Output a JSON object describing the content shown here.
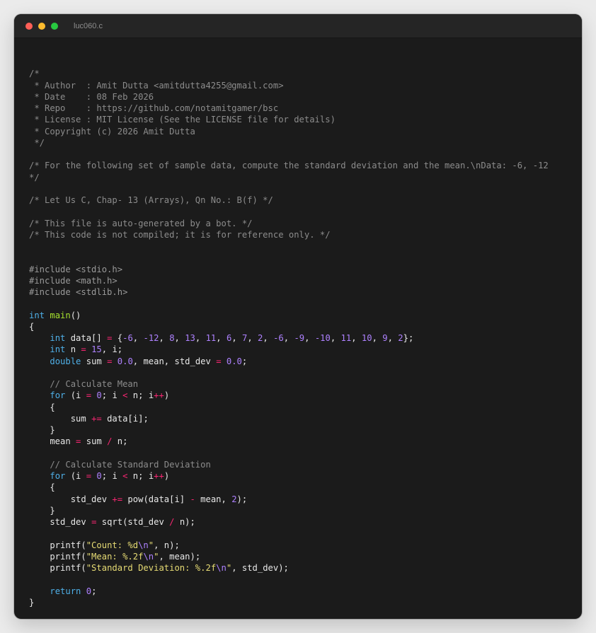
{
  "window": {
    "title": "luc060.c"
  },
  "colors": {
    "background": "#1b1b1b",
    "titlebar": "#252525",
    "close": "#ff5f57",
    "minimize": "#febc2e",
    "maximize": "#28c840",
    "comment": "#8c8c8c",
    "keyword": "#4fb0e8",
    "function": "#a6e22e",
    "number": "#ae81ff",
    "operator": "#f92672",
    "string": "#e6db74"
  },
  "code": {
    "lines": [
      [],
      [
        {
          "t": "/*",
          "c": "comment"
        }
      ],
      [
        {
          "t": " * Author  : Amit Dutta <amitdutta4255@gmail.com>",
          "c": "comment"
        }
      ],
      [
        {
          "t": " * Date    : 08 Feb 2026",
          "c": "comment"
        }
      ],
      [
        {
          "t": " * Repo    : https://github.com/notamitgamer/bsc",
          "c": "comment"
        }
      ],
      [
        {
          "t": " * License : MIT License (See the LICENSE file for details)",
          "c": "comment"
        }
      ],
      [
        {
          "t": " * Copyright (c) 2026 Amit Dutta",
          "c": "comment"
        }
      ],
      [
        {
          "t": " */",
          "c": "comment"
        }
      ],
      [],
      [
        {
          "t": "/* For the following set of sample data, compute the standard deviation and the mean.\\nData: -6, -12",
          "c": "comment"
        }
      ],
      [
        {
          "t": "*/",
          "c": "comment"
        }
      ],
      [],
      [
        {
          "t": "/* Let Us C, Chap- 13 (Arrays), Qn No.: B(f) */",
          "c": "comment"
        }
      ],
      [],
      [
        {
          "t": "/* This file is auto-generated by a bot. */",
          "c": "comment"
        }
      ],
      [
        {
          "t": "/* This code is not compiled; it is for reference only. */",
          "c": "comment"
        }
      ],
      [],
      [],
      [
        {
          "t": "#include <stdio.h>",
          "c": "pre"
        }
      ],
      [
        {
          "t": "#include <math.h>",
          "c": "pre"
        }
      ],
      [
        {
          "t": "#include <stdlib.h>",
          "c": "pre"
        }
      ],
      [],
      [
        {
          "t": "int",
          "c": "type"
        },
        {
          "t": " ",
          "c": "plain"
        },
        {
          "t": "main",
          "c": "fn"
        },
        {
          "t": "()",
          "c": "plain"
        }
      ],
      [
        {
          "t": "{",
          "c": "plain"
        }
      ],
      [
        {
          "t": "    ",
          "c": "plain"
        },
        {
          "t": "int",
          "c": "type"
        },
        {
          "t": " data[] ",
          "c": "plain"
        },
        {
          "t": "=",
          "c": "op"
        },
        {
          "t": " {",
          "c": "plain"
        },
        {
          "t": "-6",
          "c": "num"
        },
        {
          "t": ", ",
          "c": "plain"
        },
        {
          "t": "-12",
          "c": "num"
        },
        {
          "t": ", ",
          "c": "plain"
        },
        {
          "t": "8",
          "c": "num"
        },
        {
          "t": ", ",
          "c": "plain"
        },
        {
          "t": "13",
          "c": "num"
        },
        {
          "t": ", ",
          "c": "plain"
        },
        {
          "t": "11",
          "c": "num"
        },
        {
          "t": ", ",
          "c": "plain"
        },
        {
          "t": "6",
          "c": "num"
        },
        {
          "t": ", ",
          "c": "plain"
        },
        {
          "t": "7",
          "c": "num"
        },
        {
          "t": ", ",
          "c": "plain"
        },
        {
          "t": "2",
          "c": "num"
        },
        {
          "t": ", ",
          "c": "plain"
        },
        {
          "t": "-6",
          "c": "num"
        },
        {
          "t": ", ",
          "c": "plain"
        },
        {
          "t": "-9",
          "c": "num"
        },
        {
          "t": ", ",
          "c": "plain"
        },
        {
          "t": "-10",
          "c": "num"
        },
        {
          "t": ", ",
          "c": "plain"
        },
        {
          "t": "11",
          "c": "num"
        },
        {
          "t": ", ",
          "c": "plain"
        },
        {
          "t": "10",
          "c": "num"
        },
        {
          "t": ", ",
          "c": "plain"
        },
        {
          "t": "9",
          "c": "num"
        },
        {
          "t": ", ",
          "c": "plain"
        },
        {
          "t": "2",
          "c": "num"
        },
        {
          "t": "};",
          "c": "plain"
        }
      ],
      [
        {
          "t": "    ",
          "c": "plain"
        },
        {
          "t": "int",
          "c": "type"
        },
        {
          "t": " n ",
          "c": "plain"
        },
        {
          "t": "=",
          "c": "op"
        },
        {
          "t": " ",
          "c": "plain"
        },
        {
          "t": "15",
          "c": "num"
        },
        {
          "t": ", i;",
          "c": "plain"
        }
      ],
      [
        {
          "t": "    ",
          "c": "plain"
        },
        {
          "t": "double",
          "c": "type"
        },
        {
          "t": " sum ",
          "c": "plain"
        },
        {
          "t": "=",
          "c": "op"
        },
        {
          "t": " ",
          "c": "plain"
        },
        {
          "t": "0.0",
          "c": "num"
        },
        {
          "t": ", mean, std_dev ",
          "c": "plain"
        },
        {
          "t": "=",
          "c": "op"
        },
        {
          "t": " ",
          "c": "plain"
        },
        {
          "t": "0.0",
          "c": "num"
        },
        {
          "t": ";",
          "c": "plain"
        }
      ],
      [],
      [
        {
          "t": "    // Calculate Mean",
          "c": "comment"
        }
      ],
      [
        {
          "t": "    ",
          "c": "plain"
        },
        {
          "t": "for",
          "c": "type"
        },
        {
          "t": " (i ",
          "c": "plain"
        },
        {
          "t": "=",
          "c": "op"
        },
        {
          "t": " ",
          "c": "plain"
        },
        {
          "t": "0",
          "c": "num"
        },
        {
          "t": "; i ",
          "c": "plain"
        },
        {
          "t": "<",
          "c": "op"
        },
        {
          "t": " n; i",
          "c": "plain"
        },
        {
          "t": "++",
          "c": "op"
        },
        {
          "t": ")",
          "c": "plain"
        }
      ],
      [
        {
          "t": "    {",
          "c": "plain"
        }
      ],
      [
        {
          "t": "        sum ",
          "c": "plain"
        },
        {
          "t": "+=",
          "c": "op"
        },
        {
          "t": " data[i];",
          "c": "plain"
        }
      ],
      [
        {
          "t": "    }",
          "c": "plain"
        }
      ],
      [
        {
          "t": "    mean ",
          "c": "plain"
        },
        {
          "t": "=",
          "c": "op"
        },
        {
          "t": " sum ",
          "c": "plain"
        },
        {
          "t": "/",
          "c": "op"
        },
        {
          "t": " n;",
          "c": "plain"
        }
      ],
      [],
      [
        {
          "t": "    // Calculate Standard Deviation",
          "c": "comment"
        }
      ],
      [
        {
          "t": "    ",
          "c": "plain"
        },
        {
          "t": "for",
          "c": "type"
        },
        {
          "t": " (i ",
          "c": "plain"
        },
        {
          "t": "=",
          "c": "op"
        },
        {
          "t": " ",
          "c": "plain"
        },
        {
          "t": "0",
          "c": "num"
        },
        {
          "t": "; i ",
          "c": "plain"
        },
        {
          "t": "<",
          "c": "op"
        },
        {
          "t": " n; i",
          "c": "plain"
        },
        {
          "t": "++",
          "c": "op"
        },
        {
          "t": ")",
          "c": "plain"
        }
      ],
      [
        {
          "t": "    {",
          "c": "plain"
        }
      ],
      [
        {
          "t": "        std_dev ",
          "c": "plain"
        },
        {
          "t": "+=",
          "c": "op"
        },
        {
          "t": " pow(data[i] ",
          "c": "plain"
        },
        {
          "t": "-",
          "c": "op"
        },
        {
          "t": " mean, ",
          "c": "plain"
        },
        {
          "t": "2",
          "c": "num"
        },
        {
          "t": ");",
          "c": "plain"
        }
      ],
      [
        {
          "t": "    }",
          "c": "plain"
        }
      ],
      [
        {
          "t": "    std_dev ",
          "c": "plain"
        },
        {
          "t": "=",
          "c": "op"
        },
        {
          "t": " sqrt(std_dev ",
          "c": "plain"
        },
        {
          "t": "/",
          "c": "op"
        },
        {
          "t": " n);",
          "c": "plain"
        }
      ],
      [],
      [
        {
          "t": "    printf(",
          "c": "plain"
        },
        {
          "t": "\"Count: %d",
          "c": "str"
        },
        {
          "t": "\\n",
          "c": "esc"
        },
        {
          "t": "\"",
          "c": "str"
        },
        {
          "t": ", n);",
          "c": "plain"
        }
      ],
      [
        {
          "t": "    printf(",
          "c": "plain"
        },
        {
          "t": "\"Mean: %.2f",
          "c": "str"
        },
        {
          "t": "\\n",
          "c": "esc"
        },
        {
          "t": "\"",
          "c": "str"
        },
        {
          "t": ", mean);",
          "c": "plain"
        }
      ],
      [
        {
          "t": "    printf(",
          "c": "plain"
        },
        {
          "t": "\"Standard Deviation: %.2f",
          "c": "str"
        },
        {
          "t": "\\n",
          "c": "esc"
        },
        {
          "t": "\"",
          "c": "str"
        },
        {
          "t": ", std_dev);",
          "c": "plain"
        }
      ],
      [],
      [
        {
          "t": "    ",
          "c": "plain"
        },
        {
          "t": "return",
          "c": "type"
        },
        {
          "t": " ",
          "c": "plain"
        },
        {
          "t": "0",
          "c": "num"
        },
        {
          "t": ";",
          "c": "plain"
        }
      ],
      [
        {
          "t": "}",
          "c": "plain"
        }
      ]
    ]
  }
}
